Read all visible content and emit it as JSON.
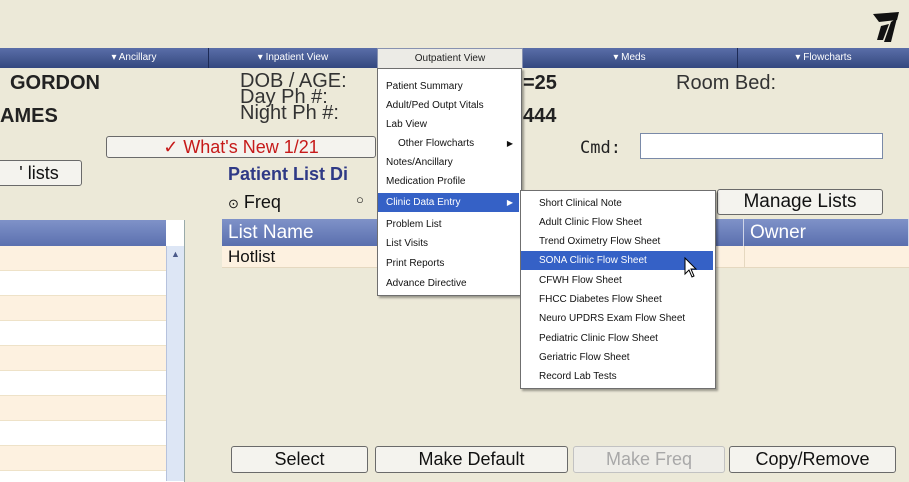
{
  "menubar": {
    "items": [
      {
        "label": "▾ Ancillary"
      },
      {
        "label": "▾ Inpatient View"
      },
      {
        "label": "Outpatient View"
      },
      {
        "label": "▾ Meds"
      },
      {
        "label": "▾ Flowcharts"
      }
    ]
  },
  "patient": {
    "last_name": "GORDON",
    "first_name": "AMES",
    "dob_label": "DOB / AGE:",
    "day_ph_label": "Day Ph #:",
    "night_ph_label": "Night Ph #:",
    "age_fragment": "=25",
    "phone_fragment": "444",
    "room_bed_label": "Room Bed:"
  },
  "whats_new": "✓ What's New 1/21",
  "cmd_label": "Cmd:",
  "lists_button": "' lists",
  "patient_list_title": "Patient List Di",
  "freq_radio": "Freq",
  "manage_lists": "Manage Lists",
  "list_table": {
    "col1": "List Name",
    "col2": "Owner",
    "rows": [
      {
        "name": "Hotlist",
        "owner": ""
      }
    ]
  },
  "buttons": {
    "select": "Select",
    "make_default": "Make Default",
    "make_freq": "Make Freq",
    "copy_remove": "Copy/Remove"
  },
  "outpatient_menu": {
    "items": [
      "Patient Summary",
      "Adult/Ped Outpt Vitals",
      "Lab View",
      "Other Flowcharts",
      "Notes/Ancillary",
      "Medication Profile",
      "Clinic Data Entry",
      "Problem List",
      "List Visits",
      "Print Reports",
      "Advance Directive"
    ]
  },
  "clinic_submenu": {
    "items": [
      "Short Clinical Note",
      "Adult Clinic Flow Sheet",
      "Trend Oximetry Flow Sheet",
      "SONA Clinic Flow Sheet",
      "CFWH Flow Sheet",
      "FHCC Diabetes Flow Sheet",
      "Neuro UPDRS Exam Flow Sheet",
      "Pediatric Clinic Flow Sheet",
      "Geriatric Flow Sheet",
      "Record Lab Tests"
    ]
  }
}
